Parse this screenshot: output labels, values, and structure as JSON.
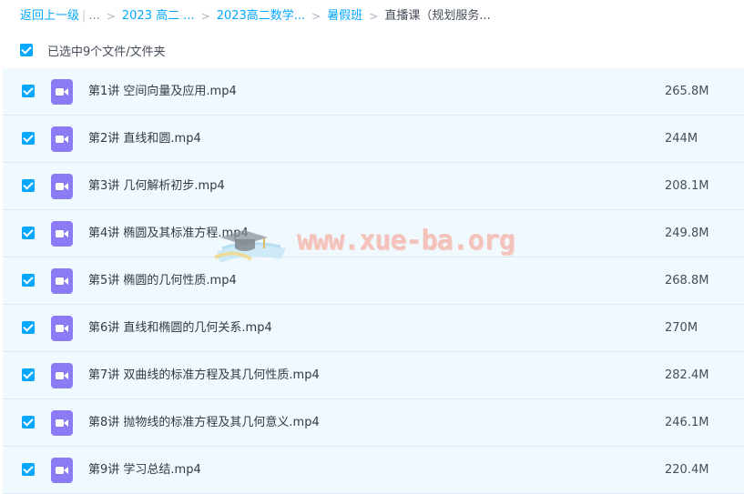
{
  "breadcrumb": {
    "back": "返回上一级",
    "ellipsis": "...",
    "items": [
      "2023 高二 ...",
      "2023高二数学...",
      "暑假班"
    ],
    "current": "直播课（规划服务..."
  },
  "selection": {
    "label": "已选中9个文件/文件夹",
    "checked": true
  },
  "files": [
    {
      "name": "第1讲 空间向量及应用.mp4",
      "size": "265.8M",
      "checked": true,
      "icon": "video-file-icon"
    },
    {
      "name": "第2讲 直线和圆.mp4",
      "size": "244M",
      "checked": true,
      "icon": "video-file-icon"
    },
    {
      "name": "第3讲 几何解析初步.mp4",
      "size": "208.1M",
      "checked": true,
      "icon": "video-file-icon"
    },
    {
      "name": "第4讲 椭圆及其标准方程.mp4",
      "size": "249.8M",
      "checked": true,
      "icon": "video-file-icon"
    },
    {
      "name": "第5讲 椭圆的几何性质.mp4",
      "size": "268.8M",
      "checked": true,
      "icon": "video-file-icon"
    },
    {
      "name": "第6讲 直线和椭圆的几何关系.mp4",
      "size": "270M",
      "checked": true,
      "icon": "video-file-icon"
    },
    {
      "name": "第7讲 双曲线的标准方程及其几何性质.mp4",
      "size": "282.4M",
      "checked": true,
      "icon": "video-file-icon"
    },
    {
      "name": "第8讲 抛物线的标准方程及其几何意义.mp4",
      "size": "246.1M",
      "checked": true,
      "icon": "video-file-icon"
    },
    {
      "name": "第9讲 学习总结.mp4",
      "size": "220.4M",
      "checked": true,
      "icon": "video-file-icon"
    }
  ],
  "watermark": {
    "text": "www.xue-ba.org"
  },
  "colors": {
    "accent": "#06a7ff",
    "row_selected": "#eff9fe",
    "video_icon": "#8b7cf6",
    "watermark": "#f4b9b0"
  }
}
